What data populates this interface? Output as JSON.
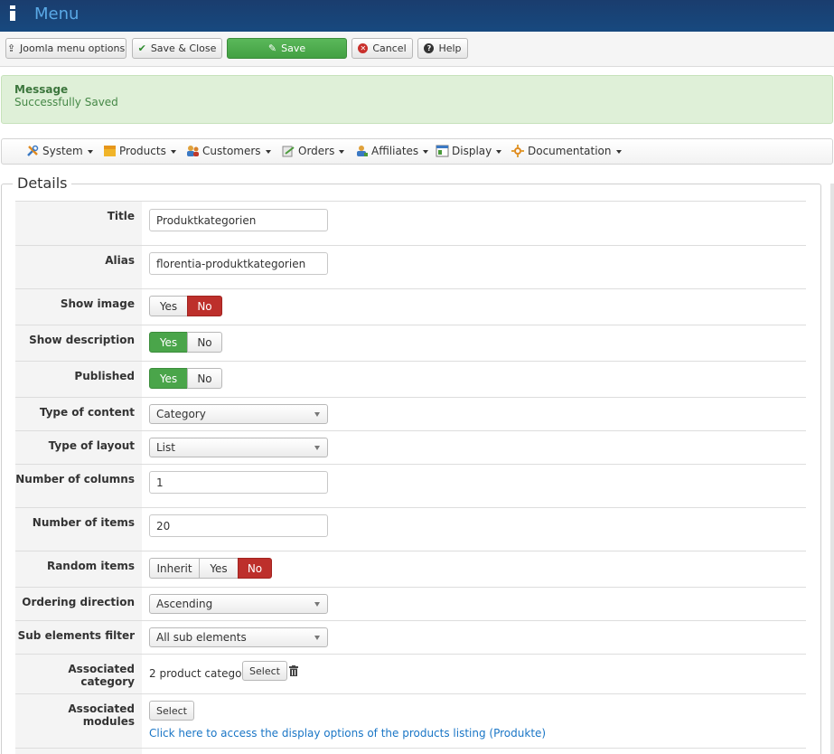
{
  "header": {
    "title": "Menu"
  },
  "toolbar": {
    "joomla_options": "Joomla menu options",
    "save_close": "Save & Close",
    "save": "Save",
    "cancel": "Cancel",
    "help": "Help"
  },
  "message": {
    "title": "Message",
    "text": "Successfully Saved"
  },
  "nav": {
    "system": "System",
    "products": "Products",
    "customers": "Customers",
    "orders": "Orders",
    "affiliates": "Affiliates",
    "display": "Display",
    "documentation": "Documentation"
  },
  "details": {
    "legend": "Details",
    "title": {
      "label": "Title",
      "value": "Produktkategorien"
    },
    "alias": {
      "label": "Alias",
      "value": "florentia-produktkategorien"
    },
    "show_image": {
      "label": "Show image",
      "options": [
        "Yes",
        "No"
      ],
      "selected": "No"
    },
    "show_description": {
      "label": "Show description",
      "options": [
        "Yes",
        "No"
      ],
      "selected": "Yes"
    },
    "published": {
      "label": "Published",
      "options": [
        "Yes",
        "No"
      ],
      "selected": "Yes"
    },
    "type_of_content": {
      "label": "Type of content",
      "value": "Category"
    },
    "type_of_layout": {
      "label": "Type of layout",
      "value": "List"
    },
    "number_of_columns": {
      "label": "Number of columns",
      "value": "1"
    },
    "number_of_items": {
      "label": "Number of items",
      "value": "20"
    },
    "random_items": {
      "label": "Random items",
      "options": [
        "Inherit",
        "Yes",
        "No"
      ],
      "selected": "No"
    },
    "ordering_direction": {
      "label": "Ordering direction",
      "value": "Ascending"
    },
    "sub_elements_filter": {
      "label": "Sub elements filter",
      "value": "All sub elements"
    },
    "associated_category": {
      "label": "Associated category",
      "value": "2 product category",
      "select": "Select"
    },
    "associated_modules": {
      "label": "Associated modules",
      "select": "Select",
      "link": "Click here to access the display options of the products listing (Produkte)"
    }
  },
  "colors": {
    "header_bg": "#17497f",
    "green": "#4aa54a",
    "red": "#bd2f2b",
    "link": "#1a76c6",
    "message_bg": "#dff0d8"
  }
}
